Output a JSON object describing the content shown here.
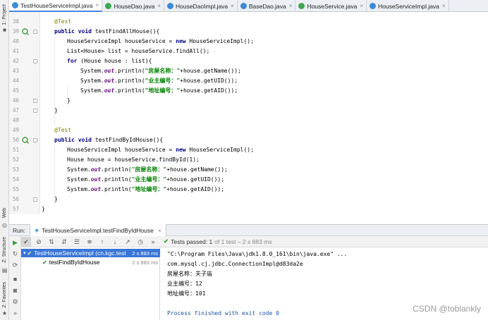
{
  "left_strip": {
    "project": "1: Project",
    "web": "Web",
    "structure": "Z: Structure",
    "favorites": "2: Favorites"
  },
  "tabs": [
    {
      "label": "TestHouseServiceImpl.java",
      "icon": "class-icon",
      "active": true
    },
    {
      "label": "HouseDao.java",
      "icon": "interface-icon",
      "active": false
    },
    {
      "label": "HouseDaoImpl.java",
      "icon": "class-icon",
      "active": false
    },
    {
      "label": "BaseDao.java",
      "icon": "class-icon",
      "active": false
    },
    {
      "label": "HouseService.java",
      "icon": "interface-icon",
      "active": false
    },
    {
      "label": "HouseServiceImpl.java",
      "icon": "class-icon",
      "active": false
    }
  ],
  "editor": {
    "line_numbers": [
      "38",
      "39",
      "40",
      "41",
      "42",
      "43",
      "44",
      "45",
      "46",
      "47",
      "48",
      "49",
      "50",
      "51",
      "52",
      "53",
      "54",
      "55",
      "56",
      "57"
    ],
    "code": {
      "l38": "@Test",
      "l39_kw1": "public",
      "l39_kw2": "void",
      "l39_rest": " testFindAllHouse(){",
      "l40_a": "HouseServiceImpl houseService = ",
      "l40_kw": "new",
      "l40_b": " HouseServiceImpl();",
      "l41": "List<House> list = houseService.findAll();",
      "l42_kw": "for",
      "l42_rest": " (House house : list){",
      "l43_a": "System.",
      "l43_out": "out",
      "l43_b": ".println(",
      "l43_str": "\"房屋名称：\"",
      "l43_c": "+house.getName());",
      "l44_str": "\"业主编号：\"",
      "l44_c": "+house.getUID());",
      "l45_str": "\"地址编号：\"",
      "l45_c": "+house.getAID());",
      "l46": "}",
      "l47": "}",
      "l49": "@Test",
      "l50_rest": " testFindByIdHouse(){",
      "l52": "House house = houseService.findById(1);",
      "l56": "}",
      "l57": "}"
    }
  },
  "run": {
    "label": "Run:",
    "tab": "TestHouseServiceImpl.testFindByIdHouse",
    "status_prefix": "Tests passed:",
    "status_count": "1",
    "status_suffix": "of 1 test – 2 s 883 ms",
    "tree": [
      {
        "label": "TestHouseServiceImpl (cn.kgc.test",
        "time": "2 s 883 ms",
        "selected": true
      },
      {
        "label": "testFindByIdHouse",
        "time": "2 s 883 ms",
        "selected": false
      }
    ],
    "console": [
      "\"C:\\Program Files\\Java\\jdk1.8.0_161\\bin\\java.exe\" ...",
      "com.mysql.cj.jdbc.ConnectionImpl@d83da2e",
      "房屋名称：夫子庙",
      "业主编号：12",
      "地址编号：101",
      "",
      "Process finished with exit code 0"
    ]
  },
  "watermark": "CSDN @toblankly",
  "colors": {
    "keyword": "#000080",
    "string": "#008000",
    "annotation": "#808000",
    "selection": "#3875d7",
    "pass": "#3f9d3f"
  }
}
